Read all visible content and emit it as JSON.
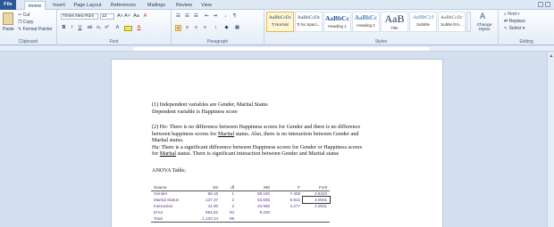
{
  "tabs": [
    "File",
    "Home",
    "Insert",
    "Page Layout",
    "References",
    "Mailings",
    "Review",
    "View"
  ],
  "active_tab": "Home",
  "clipboard": {
    "paste": "Paste",
    "cut": "Cut",
    "copy": "Copy",
    "format_painter": "Format Painter",
    "group": "Clipboard"
  },
  "font": {
    "family": "Times New Rom",
    "size": "12",
    "group": "Font",
    "bold": "B",
    "italic": "I",
    "underline": "U",
    "grow": "A˄",
    "shrink": "A˅",
    "aa": "Aa",
    "clear": "A"
  },
  "paragraph": {
    "group": "Paragraph"
  },
  "styles": {
    "group": "Styles",
    "items": [
      {
        "sample": "AaBbCcDc",
        "name": "¶ Normal"
      },
      {
        "sample": "AaBbCcDc",
        "name": "¶ No Spaci..."
      },
      {
        "sample": "AaBbCc",
        "name": "Heading 1"
      },
      {
        "sample": "AaBbCc",
        "name": "Heading 2"
      },
      {
        "sample": "AaB",
        "name": "Title"
      },
      {
        "sample": "AaBbCcI",
        "name": "Subtitle"
      },
      {
        "sample": "AaBbCcDc",
        "name": "Subtle Em..."
      }
    ],
    "change_styles": "Change Styles"
  },
  "editing": {
    "find": "Find",
    "replace": "Replace",
    "select": "Select",
    "group": "Editing"
  },
  "document": {
    "p1_line1": "(1) Independent variables are Gender, Marital Status",
    "p1_line2": "Dependent variable is  Happiness score",
    "p2_line1": "(2) Ho: There is no difference between Happiness scores for Gender and there is no difference",
    "p2_line2_a": "between happiness scores for ",
    "p2_line2_marital": "Marital",
    "p2_line2_b": " status. Also, there is no interaction between Gender and",
    "p2_line3": "Marital status.",
    "p3_line1": "Ha: There is a significant difference between Happiness scores for Gender or Happiness scores",
    "p3_line2_a": "for ",
    "p3_line2_marital": "Marital",
    "p3_line2_b": " status. There is significant interaction between Gender and Marital status",
    "anova_title": "ANOVA Table;"
  },
  "anova_table": {
    "headers": [
      "Source",
      "SS",
      "df",
      "MS",
      "F",
      "Fcrit"
    ],
    "rows": [
      [
        "Gender",
        "68.15",
        "1",
        "68.150",
        "7.408",
        "3.9423"
      ],
      [
        "Marital Status",
        "127.37",
        "2",
        "63.685",
        "6.922",
        "3.0931"
      ],
      [
        "Interaction",
        "41.90",
        "2",
        "20.950",
        "2.277",
        "3.0931"
      ],
      [
        "Error",
        "864.82",
        "94",
        "9.200",
        "",
        ""
      ],
      [
        "Total",
        "1,102.24",
        "99",
        "",
        "",
        ""
      ]
    ]
  }
}
